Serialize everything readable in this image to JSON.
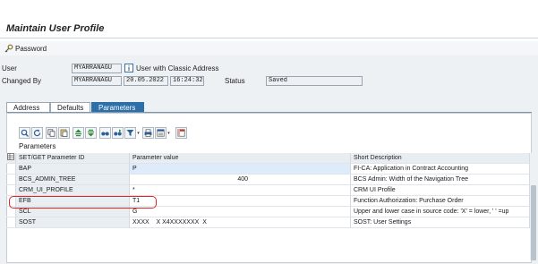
{
  "window": {
    "title": "Maintain User Profile"
  },
  "toolbar": {
    "password_label": "Password"
  },
  "header": {
    "user_label": "User",
    "user_value": "MYARRANAGU",
    "user_type_text": "User with Classic Address",
    "changed_by_label": "Changed By",
    "changed_by_value": "MYARRANAGU",
    "date_value": "20.05.2022",
    "time_value": "16:24:32",
    "status_label": "Status",
    "status_value": "Saved"
  },
  "tabs": [
    {
      "label": "Address",
      "active": false
    },
    {
      "label": "Defaults",
      "active": false
    },
    {
      "label": "Parameters",
      "active": true
    }
  ],
  "params_toolbar": {
    "icons": [
      "details-icon",
      "refresh-icon",
      "copy-icon",
      "paste-icon",
      "sort-ascending-icon",
      "sort-descending-icon",
      "find-icon",
      "find-next-icon",
      "filter-icon",
      "print-icon",
      "export-icon",
      "layout-icon"
    ]
  },
  "parameters": {
    "section_label": "Parameters",
    "columns": [
      "SET/GET Parameter ID",
      "Parameter value",
      "Short Description"
    ],
    "rows": [
      {
        "id": "BAP",
        "value": "P",
        "desc": "FI-CA: Application in Contract Accounting"
      },
      {
        "id": "BCS_ADMIN_TREE",
        "value": "400",
        "desc": "BCS Admin: Width of the Navigation Tree"
      },
      {
        "id": "CRM_UI_PROFILE",
        "value": "*",
        "desc": "CRM UI Profile"
      },
      {
        "id": "EFB",
        "value": "T1",
        "desc": "Function Authorization: Purchase Order"
      },
      {
        "id": "SCL",
        "value": "G",
        "desc": "Upper and lower case in source code: 'X' = lower, ' ' =up"
      },
      {
        "id": "SOST",
        "value": "XXXX    X X4XXXXXXX  X",
        "desc": "SOST: User Settings"
      }
    ],
    "highlighted_row": "EFB",
    "highlight_color": "#e02424"
  },
  "colors": {
    "tab_active": "#2d6fa8",
    "brand_blue": "#3d6fa8"
  }
}
